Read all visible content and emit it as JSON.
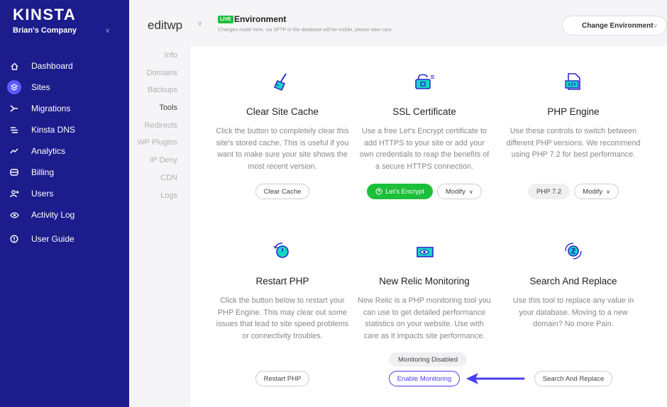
{
  "sidebar": {
    "logo": "KINSTA",
    "company": "Brian's Company",
    "items": [
      {
        "label": "Dashboard",
        "icon": "home-icon"
      },
      {
        "label": "Sites",
        "icon": "layers-icon"
      },
      {
        "label": "Migrations",
        "icon": "migrate-icon"
      },
      {
        "label": "Kinsta DNS",
        "icon": "dns-icon"
      },
      {
        "label": "Analytics",
        "icon": "analytics-icon"
      },
      {
        "label": "Billing",
        "icon": "billing-icon"
      },
      {
        "label": "Users",
        "icon": "users-icon"
      },
      {
        "label": "Activity Log",
        "icon": "eye-icon"
      },
      {
        "label": "User Guide",
        "icon": "info-icon"
      }
    ]
  },
  "topbar": {
    "site_name": "editwp",
    "live_badge": "LIVE",
    "env_title": "Environment",
    "env_subtitle": "Changes made here, via SFTP or the database will be visible, please take care.",
    "change_env_label": "Change Environment"
  },
  "subnav": {
    "items": [
      "Info",
      "Domains",
      "Backups",
      "Tools",
      "Redirects",
      "WP Plugins",
      "IP Deny",
      "CDN",
      "Logs"
    ],
    "active": "Tools"
  },
  "tools": {
    "clear_cache": {
      "title": "Clear Site Cache",
      "desc": "Click the button to completely clear this site's stored cache. This is useful if you want to make sure your site shows the most recent version.",
      "button": "Clear Cache"
    },
    "ssl": {
      "title": "SSL Certificate",
      "desc": "Use a free Let's Encrypt certificate to add HTTPS to your site or add your own credentials to reap the benefits of a secure HTTPS connection.",
      "button_primary": "Let's Encrypt",
      "button_modify": "Modify"
    },
    "php": {
      "title": "PHP Engine",
      "desc": "Use these controls to switch between different PHP versions. We recommend using PHP 7.2 for best performance.",
      "version": "PHP 7.2",
      "button_modify": "Modify"
    },
    "restart": {
      "title": "Restart PHP",
      "desc": "Click the button below to restart your PHP Engine. This may clear out some issues that lead to site speed problems or connectivity troubles.",
      "button": "Restart PHP"
    },
    "relic": {
      "title": "New Relic Monitoring",
      "desc": "New Relic is a PHP monitoring tool you can use to get detailed performance statistics on your website. Use with care as it impacts site performance.",
      "status": "Monitoring Disabled",
      "button": "Enable Monitoring"
    },
    "search_replace": {
      "title": "Search And Replace",
      "desc": "Use this tool to replace any value in your database. Moving to a new domain? No more Pain.",
      "button": "Search And Replace"
    }
  },
  "colors": {
    "sidebar_bg": "#1c1c8c",
    "accent": "#5b5bff",
    "green": "#1dbf3a",
    "arrow": "#4a3df2"
  }
}
